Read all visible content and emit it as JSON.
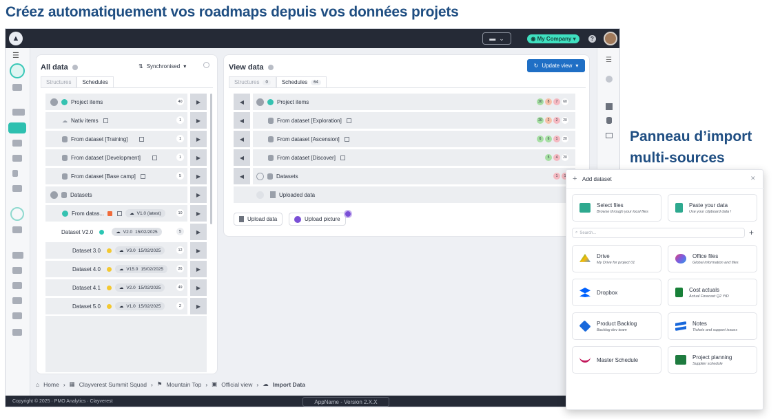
{
  "headline": "Créez automatiquement vos roadmaps depuis vos données projets",
  "side_title": {
    "line1": "Panneau d’import",
    "line2": "multi-sources"
  },
  "topbar": {
    "company": "◉ My Company ▾",
    "help": "?"
  },
  "all_data": {
    "title": "All data",
    "sync": "Synchronised",
    "tabs": [
      "Structures",
      "Schedules"
    ],
    "rows": [
      {
        "label": "Project items",
        "count": "40"
      },
      {
        "label": "Nativ items",
        "count": "1"
      },
      {
        "label": "From dataset [Training]",
        "count": "1"
      },
      {
        "label": "From dataset [Development]",
        "count": "1"
      },
      {
        "label": "From dataset [Base camp]",
        "count": "5"
      },
      {
        "label": "Datasets"
      },
      {
        "label": "From datas...",
        "version": "V1.0 (latest)",
        "count": "10"
      },
      {
        "label": "Dataset V2.0",
        "version": "V2.0",
        "date": "15/02/2025",
        "count": "5"
      },
      {
        "label": "Dataset 3.0",
        "version": "V3.0",
        "date": "15/02/2025",
        "count": "12"
      },
      {
        "label": "Dataset 4.0",
        "version": "V15.0",
        "date": "15/02/2025",
        "count": "26"
      },
      {
        "label": "Dataset 4.1",
        "version": "V2.0",
        "date": "15/02/2025",
        "count": "49"
      },
      {
        "label": "Dataset 5.0",
        "version": "V1.0",
        "date": "15/02/2025",
        "count": "2"
      }
    ]
  },
  "view_data": {
    "title": "View data",
    "update": "Update view",
    "tabs": [
      {
        "label": "Structures",
        "count": "0"
      },
      {
        "label": "Schedules",
        "count": "64"
      }
    ],
    "rows": [
      {
        "label": "Project items",
        "badges": [
          "20",
          "8",
          "7",
          "60"
        ]
      },
      {
        "label": "From dataset [Exploration]",
        "badges": [
          "20",
          "2",
          "2",
          "20"
        ]
      },
      {
        "label": "From dataset [Ascension]",
        "badges": [
          "6",
          "6",
          "1",
          "20"
        ]
      },
      {
        "label": "From dataset [Discover]",
        "badges": [
          "5",
          "4",
          "20"
        ]
      },
      {
        "label": "Datasets",
        "badges": [
          "1",
          "1"
        ]
      },
      {
        "label": "Uploaded data"
      }
    ],
    "upload_data": "Upload data",
    "upload_picture": "Upload picture"
  },
  "breadcrumb": [
    "Home",
    "Clayverest Summit Squad",
    "Mountain Top",
    "Official view",
    "Import Data"
  ],
  "footer": {
    "copyright": "Copyright © 2025 · PMO Analytics · Clayverest",
    "app": "AppName - Version 2.X.X"
  },
  "modal": {
    "title": "Add dataset",
    "search_placeholder": "Search...",
    "cards": [
      {
        "title": "Select files",
        "sub": "Browse through your local files",
        "color": "#2ea98f"
      },
      {
        "title": "Paste your data",
        "sub": "Use your clipboard data !",
        "color": "#2ea98f"
      },
      {
        "title": "Drive",
        "sub": "My Drive for project 01",
        "color": "#34a853"
      },
      {
        "title": "Office files",
        "sub": "Global information and files",
        "color": "#7b5de0"
      },
      {
        "title": "Dropbox",
        "sub": "",
        "color": "#0061fe"
      },
      {
        "title": "Cost actuals",
        "sub": "Actual Forecast Q2 YtD",
        "color": "#188038"
      },
      {
        "title": "Product Backlog",
        "sub": "Backlog dev team",
        "color": "#1868db"
      },
      {
        "title": "Notes",
        "sub": "Tickets and support issues",
        "color": "#1868db"
      },
      {
        "title": "Master Schedule",
        "sub": "",
        "color": "#c2185b"
      },
      {
        "title": "Project planning",
        "sub": "Supplier schedule",
        "color": "#1e7b3f"
      }
    ]
  }
}
